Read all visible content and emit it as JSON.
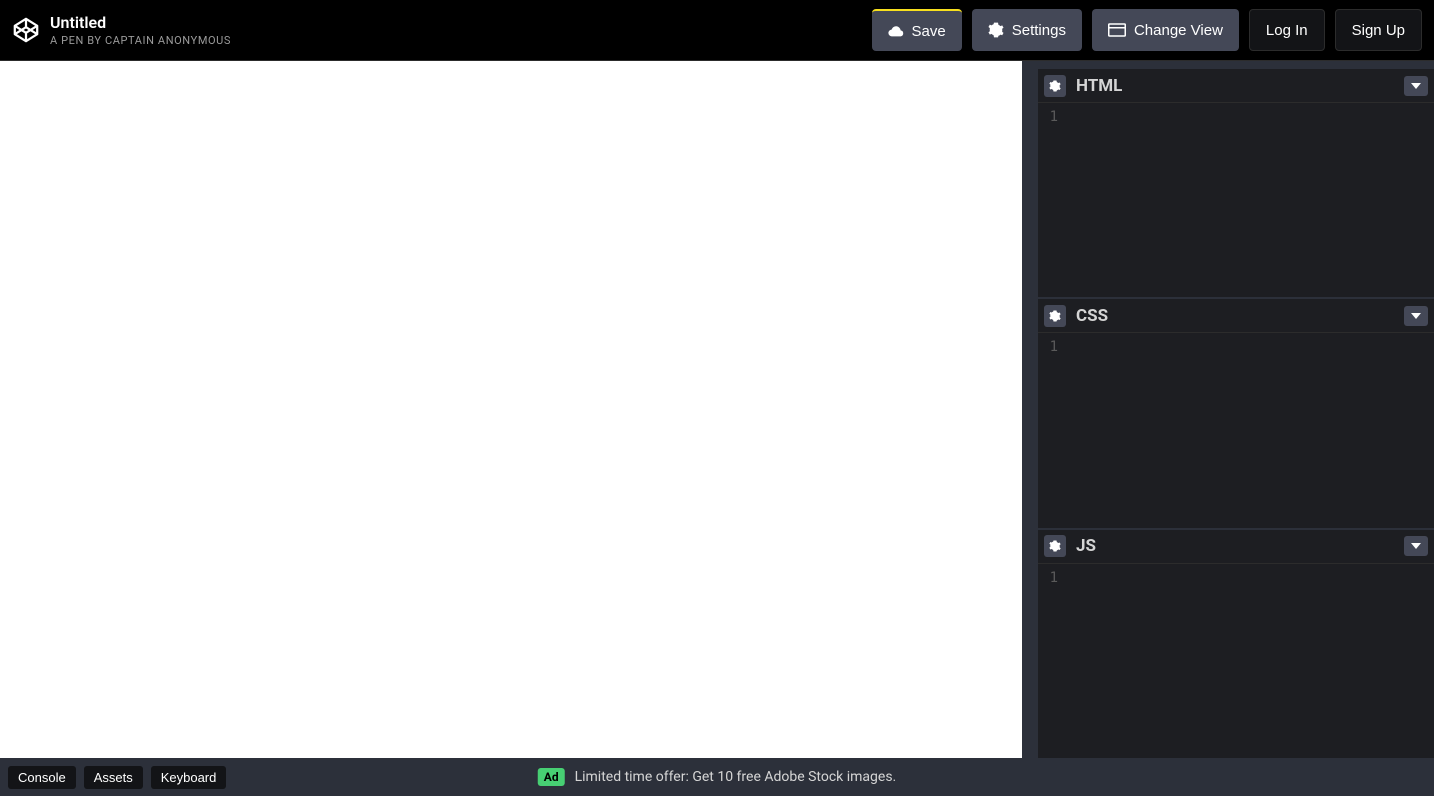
{
  "header": {
    "title": "Untitled",
    "byline": "A PEN BY CAPTAIN ANONYMOUS",
    "buttons": {
      "save": "Save",
      "settings": "Settings",
      "change_view": "Change View",
      "login": "Log In",
      "signup": "Sign Up"
    }
  },
  "editors": [
    {
      "title": "HTML",
      "line_number": "1"
    },
    {
      "title": "CSS",
      "line_number": "1"
    },
    {
      "title": "JS",
      "line_number": "1"
    }
  ],
  "footer": {
    "console": "Console",
    "assets": "Assets",
    "keyboard": "Keyboard",
    "ad_badge": "Ad",
    "ad_text": "Limited time offer: Get 10 free Adobe Stock images."
  }
}
